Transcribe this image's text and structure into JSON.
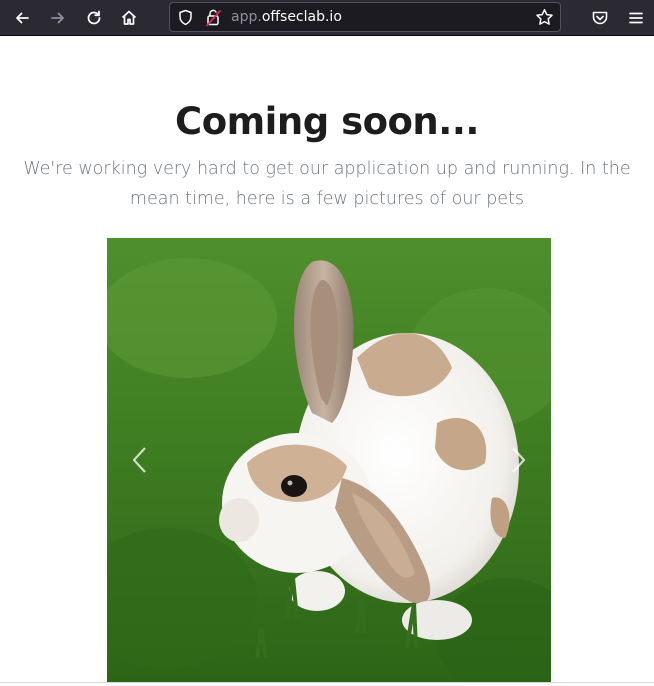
{
  "browser": {
    "url_subdomain": "app.",
    "url_domain": "offseclab.io",
    "icons": {
      "back": "arrow-left-icon",
      "forward": "arrow-right-icon",
      "reload": "reload-icon",
      "home": "home-icon",
      "tracking": "shield-icon",
      "security": "insecure-lock-icon",
      "bookmark": "star-icon",
      "pocket": "pocket-icon",
      "menu": "hamburger-menu-icon"
    },
    "colors": {
      "toolbar": "#2b2a33",
      "urlbar": "#1c1b22",
      "insecure_lock": "#e22850"
    }
  },
  "page": {
    "heading": "Coming soon...",
    "lead": "We're working very hard to get our application up and running. In the mean time, here is a few pictures of our pets"
  },
  "carousel": {
    "image_alt": "pet-rabbit-photo",
    "prev_icon": "chevron-left-icon",
    "next_icon": "chevron-right-icon"
  }
}
